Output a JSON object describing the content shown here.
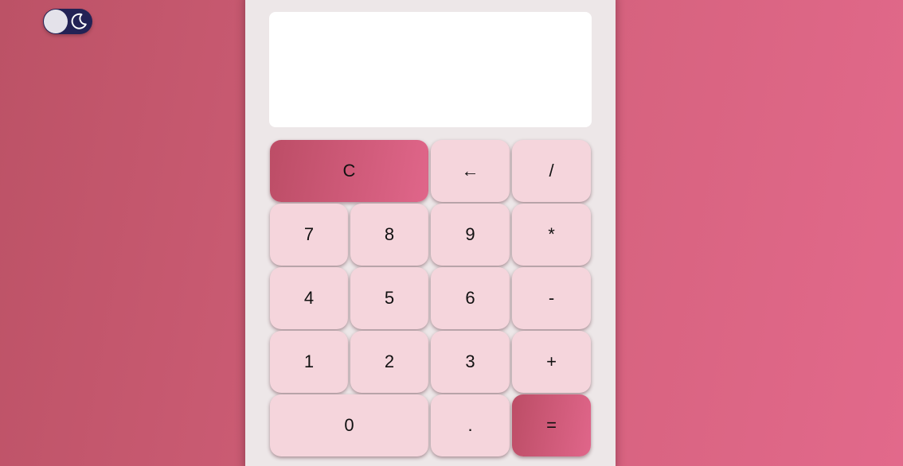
{
  "theme_toggle": {
    "icon": "moon-icon",
    "track_color": "#232255",
    "knob_color": "#e4e2ea"
  },
  "display": {
    "value": ""
  },
  "keys": {
    "clear": "C",
    "backspace": "←",
    "divide": "/",
    "seven": "7",
    "eight": "8",
    "nine": "9",
    "multiply": "*",
    "four": "4",
    "five": "5",
    "six": "6",
    "subtract": "-",
    "one": "1",
    "two": "2",
    "three": "3",
    "add": "+",
    "zero": "0",
    "decimal": ".",
    "equals": "="
  },
  "colors": {
    "background_start": "#bc5266",
    "background_end": "#e2698b",
    "calculator_body": "#ede7e8",
    "key": "#f5d5dc",
    "accent_start": "#bc4d66",
    "accent_end": "#e0668a"
  }
}
